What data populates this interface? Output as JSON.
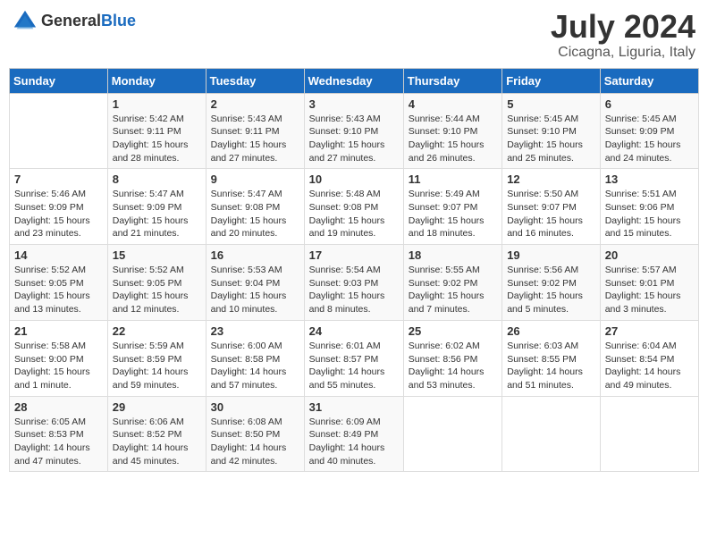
{
  "header": {
    "logo_general": "General",
    "logo_blue": "Blue",
    "title": "July 2024",
    "subtitle": "Cicagna, Liguria, Italy"
  },
  "weekdays": [
    "Sunday",
    "Monday",
    "Tuesday",
    "Wednesday",
    "Thursday",
    "Friday",
    "Saturday"
  ],
  "weeks": [
    [
      {
        "day": "",
        "info": ""
      },
      {
        "day": "1",
        "info": "Sunrise: 5:42 AM\nSunset: 9:11 PM\nDaylight: 15 hours\nand 28 minutes."
      },
      {
        "day": "2",
        "info": "Sunrise: 5:43 AM\nSunset: 9:11 PM\nDaylight: 15 hours\nand 27 minutes."
      },
      {
        "day": "3",
        "info": "Sunrise: 5:43 AM\nSunset: 9:10 PM\nDaylight: 15 hours\nand 27 minutes."
      },
      {
        "day": "4",
        "info": "Sunrise: 5:44 AM\nSunset: 9:10 PM\nDaylight: 15 hours\nand 26 minutes."
      },
      {
        "day": "5",
        "info": "Sunrise: 5:45 AM\nSunset: 9:10 PM\nDaylight: 15 hours\nand 25 minutes."
      },
      {
        "day": "6",
        "info": "Sunrise: 5:45 AM\nSunset: 9:09 PM\nDaylight: 15 hours\nand 24 minutes."
      }
    ],
    [
      {
        "day": "7",
        "info": "Sunrise: 5:46 AM\nSunset: 9:09 PM\nDaylight: 15 hours\nand 23 minutes."
      },
      {
        "day": "8",
        "info": "Sunrise: 5:47 AM\nSunset: 9:09 PM\nDaylight: 15 hours\nand 21 minutes."
      },
      {
        "day": "9",
        "info": "Sunrise: 5:47 AM\nSunset: 9:08 PM\nDaylight: 15 hours\nand 20 minutes."
      },
      {
        "day": "10",
        "info": "Sunrise: 5:48 AM\nSunset: 9:08 PM\nDaylight: 15 hours\nand 19 minutes."
      },
      {
        "day": "11",
        "info": "Sunrise: 5:49 AM\nSunset: 9:07 PM\nDaylight: 15 hours\nand 18 minutes."
      },
      {
        "day": "12",
        "info": "Sunrise: 5:50 AM\nSunset: 9:07 PM\nDaylight: 15 hours\nand 16 minutes."
      },
      {
        "day": "13",
        "info": "Sunrise: 5:51 AM\nSunset: 9:06 PM\nDaylight: 15 hours\nand 15 minutes."
      }
    ],
    [
      {
        "day": "14",
        "info": "Sunrise: 5:52 AM\nSunset: 9:05 PM\nDaylight: 15 hours\nand 13 minutes."
      },
      {
        "day": "15",
        "info": "Sunrise: 5:52 AM\nSunset: 9:05 PM\nDaylight: 15 hours\nand 12 minutes."
      },
      {
        "day": "16",
        "info": "Sunrise: 5:53 AM\nSunset: 9:04 PM\nDaylight: 15 hours\nand 10 minutes."
      },
      {
        "day": "17",
        "info": "Sunrise: 5:54 AM\nSunset: 9:03 PM\nDaylight: 15 hours\nand 8 minutes."
      },
      {
        "day": "18",
        "info": "Sunrise: 5:55 AM\nSunset: 9:02 PM\nDaylight: 15 hours\nand 7 minutes."
      },
      {
        "day": "19",
        "info": "Sunrise: 5:56 AM\nSunset: 9:02 PM\nDaylight: 15 hours\nand 5 minutes."
      },
      {
        "day": "20",
        "info": "Sunrise: 5:57 AM\nSunset: 9:01 PM\nDaylight: 15 hours\nand 3 minutes."
      }
    ],
    [
      {
        "day": "21",
        "info": "Sunrise: 5:58 AM\nSunset: 9:00 PM\nDaylight: 15 hours\nand 1 minute."
      },
      {
        "day": "22",
        "info": "Sunrise: 5:59 AM\nSunset: 8:59 PM\nDaylight: 14 hours\nand 59 minutes."
      },
      {
        "day": "23",
        "info": "Sunrise: 6:00 AM\nSunset: 8:58 PM\nDaylight: 14 hours\nand 57 minutes."
      },
      {
        "day": "24",
        "info": "Sunrise: 6:01 AM\nSunset: 8:57 PM\nDaylight: 14 hours\nand 55 minutes."
      },
      {
        "day": "25",
        "info": "Sunrise: 6:02 AM\nSunset: 8:56 PM\nDaylight: 14 hours\nand 53 minutes."
      },
      {
        "day": "26",
        "info": "Sunrise: 6:03 AM\nSunset: 8:55 PM\nDaylight: 14 hours\nand 51 minutes."
      },
      {
        "day": "27",
        "info": "Sunrise: 6:04 AM\nSunset: 8:54 PM\nDaylight: 14 hours\nand 49 minutes."
      }
    ],
    [
      {
        "day": "28",
        "info": "Sunrise: 6:05 AM\nSunset: 8:53 PM\nDaylight: 14 hours\nand 47 minutes."
      },
      {
        "day": "29",
        "info": "Sunrise: 6:06 AM\nSunset: 8:52 PM\nDaylight: 14 hours\nand 45 minutes."
      },
      {
        "day": "30",
        "info": "Sunrise: 6:08 AM\nSunset: 8:50 PM\nDaylight: 14 hours\nand 42 minutes."
      },
      {
        "day": "31",
        "info": "Sunrise: 6:09 AM\nSunset: 8:49 PM\nDaylight: 14 hours\nand 40 minutes."
      },
      {
        "day": "",
        "info": ""
      },
      {
        "day": "",
        "info": ""
      },
      {
        "day": "",
        "info": ""
      }
    ]
  ]
}
